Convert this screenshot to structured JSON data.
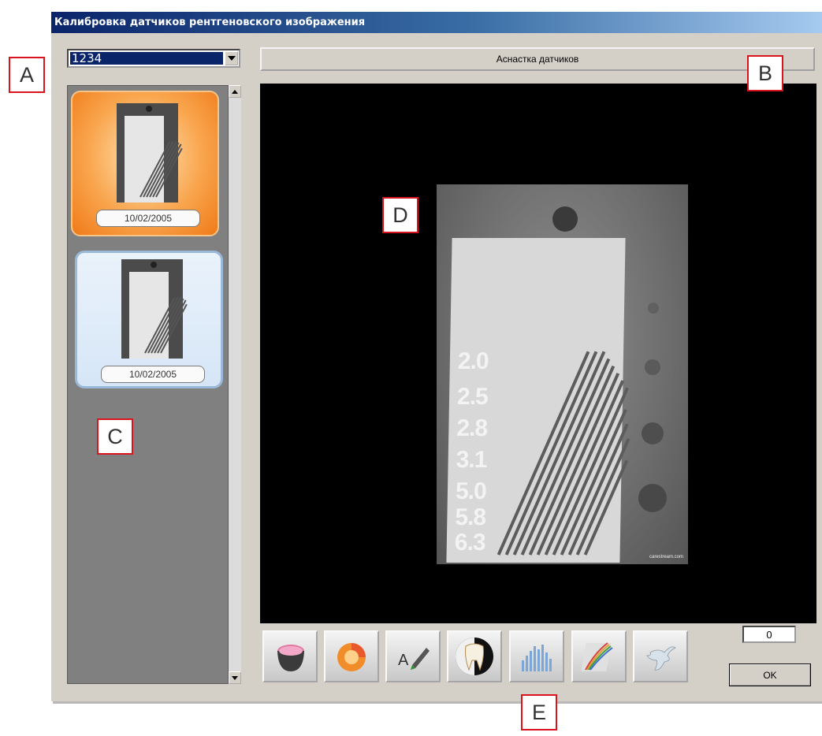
{
  "window": {
    "title": "Калибровка датчиков рентгеновского изображения"
  },
  "sensor_select": {
    "value": "1234"
  },
  "setup_button": {
    "label": "Аснастка датчиков"
  },
  "thumbnails": [
    {
      "date": "10/02/2005",
      "selected": true
    },
    {
      "date": "10/02/2005",
      "selected": false
    }
  ],
  "xray_image": {
    "scale_labels": [
      "2.0",
      "2.5",
      "2.8",
      "3.1",
      "5.0",
      "5.8",
      "6.3"
    ],
    "watermark": "carestream.com"
  },
  "toolbar": {
    "tools": [
      {
        "icon": "contrast-cup-icon"
      },
      {
        "icon": "color-wheel-icon"
      },
      {
        "icon": "annotate-pen-icon"
      },
      {
        "icon": "tooth-icon"
      },
      {
        "icon": "histogram-icon"
      },
      {
        "icon": "color-curves-icon"
      },
      {
        "icon": "dove-icon"
      }
    ]
  },
  "counter": {
    "value": "0"
  },
  "ok_button": {
    "label": "OK"
  },
  "callouts": {
    "a": "A",
    "b": "B",
    "c": "C",
    "d": "D",
    "e": "E"
  },
  "colors": {
    "title_gradient_start": "#0a246a",
    "dialog_bg": "#d4d0c8",
    "callout_border": "#d9141c"
  }
}
